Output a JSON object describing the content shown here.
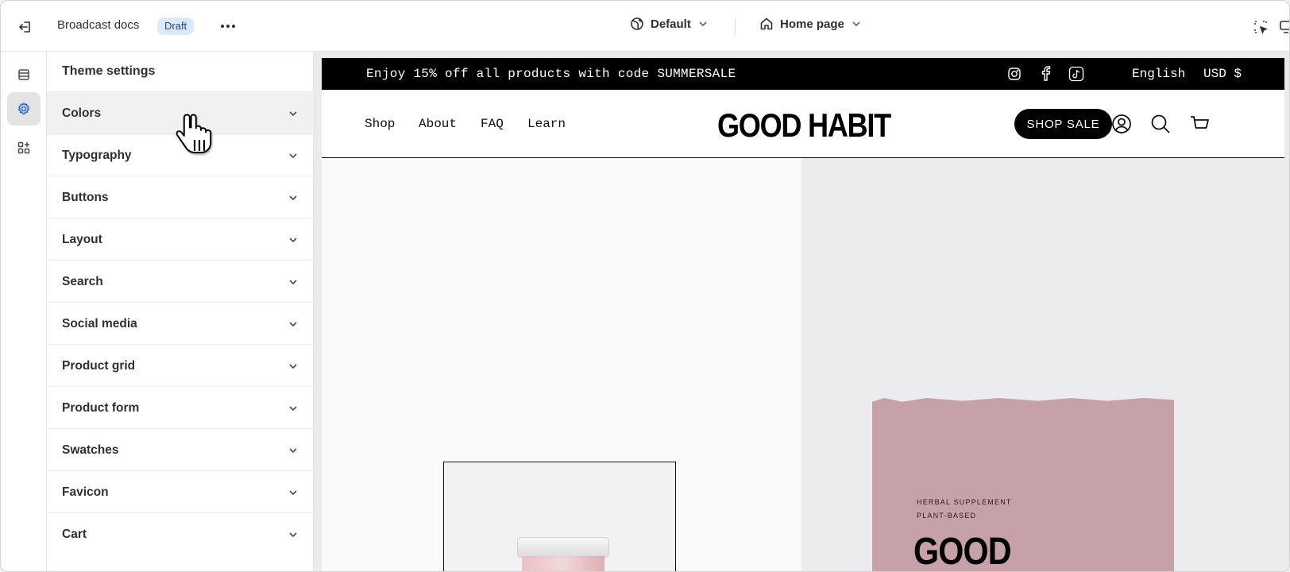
{
  "topbar": {
    "store_name": "Broadcast docs",
    "status_badge": "Draft",
    "theme_selector": "Default",
    "page_selector": "Home page"
  },
  "panel": {
    "title": "Theme settings",
    "sections": [
      {
        "label": "Colors"
      },
      {
        "label": "Typography"
      },
      {
        "label": "Buttons"
      },
      {
        "label": "Layout"
      },
      {
        "label": "Search"
      },
      {
        "label": "Social media"
      },
      {
        "label": "Product grid"
      },
      {
        "label": "Product form"
      },
      {
        "label": "Swatches"
      },
      {
        "label": "Favicon"
      },
      {
        "label": "Cart"
      }
    ]
  },
  "preview": {
    "announcement": "Enjoy 15% off all products with code SUMMERSALE",
    "language": "English",
    "currency": "USD $",
    "nav": [
      "Shop",
      "About",
      "FAQ",
      "Learn"
    ],
    "logo": "GOOD HABIT",
    "cta": "SHOP SALE",
    "pouch_line1": "HERBAL SUPPLEMENT",
    "pouch_line2": "PLANT-BASED",
    "pouch_brand": "GOOD"
  },
  "icons": {
    "exit": "exit-icon",
    "more": "more-horizontal-icon",
    "globe": "globe-icon",
    "home": "home-icon",
    "inspect": "inspect-icon",
    "sections": "sections-icon",
    "settings": "gear-icon",
    "apps": "apps-icon",
    "instagram": "instagram-icon",
    "facebook": "facebook-icon",
    "tiktok": "tiktok-icon",
    "account": "account-icon",
    "search": "search-icon",
    "cart": "cart-icon"
  },
  "colors": {
    "badge_bg": "#dbe9fb",
    "active_rail": "#e3e3e3",
    "announcement_bg": "#000000",
    "pouch": "#c7a1a8"
  }
}
